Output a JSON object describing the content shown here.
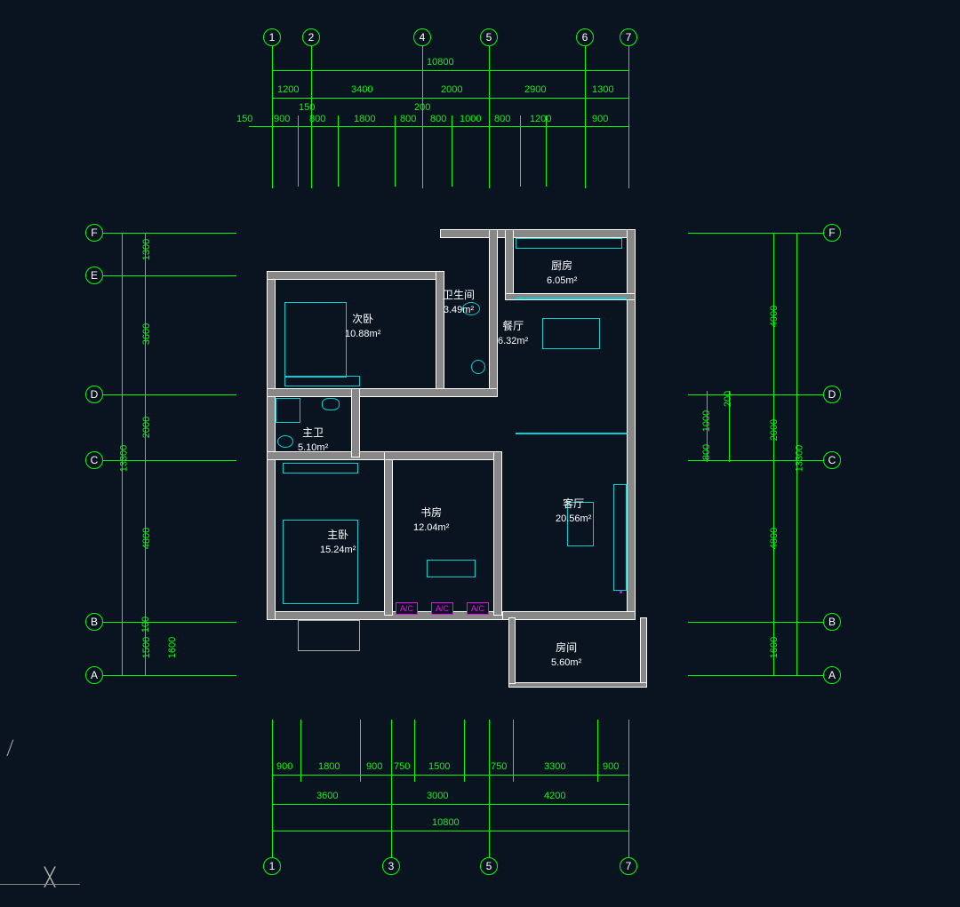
{
  "total_width": "10800",
  "total_height": "13300",
  "top_grids": [
    "1",
    "2",
    "4",
    "5",
    "6",
    "7"
  ],
  "left_grids": [
    "F",
    "E",
    "D",
    "C",
    "B",
    "A"
  ],
  "right_grids": [
    "F",
    "D",
    "C",
    "B",
    "A"
  ],
  "bottom_grids": [
    "1",
    "3",
    "5",
    "7"
  ],
  "dim_top_row1": [
    "1200",
    "3400",
    "2000",
    "2900",
    "1300"
  ],
  "dim_top_row2_edge": "150",
  "dim_top_row2": [
    "900",
    "800",
    "1800",
    "800",
    "800",
    "1000",
    "800",
    "1200",
    "900"
  ],
  "dim_top_extra": [
    "150",
    "200"
  ],
  "dim_left_col": [
    "1300",
    "3600",
    "2000",
    "4800",
    "100",
    "1500",
    "1600"
  ],
  "dim_left_total": "13300",
  "dim_right_col": [
    "4900",
    "200",
    "1000",
    "800",
    "2000",
    "4800",
    "1600"
  ],
  "dim_right_total": "13300",
  "dim_bottom_row1": [
    "900",
    "1800",
    "900",
    "750",
    "1500",
    "750",
    "3300",
    "900"
  ],
  "dim_bottom_row2": [
    "3600",
    "3000",
    "4200"
  ],
  "dim_bottom_total": "10800",
  "rooms": {
    "kitchen": {
      "name": "厨房",
      "area": "6.05m²"
    },
    "bathroom": {
      "name": "卫生间",
      "area": "3.49m²"
    },
    "dining": {
      "name": "餐厅",
      "area": "6.32m²"
    },
    "bed2": {
      "name": "次卧",
      "area": "10.88m²"
    },
    "masterbath": {
      "name": "主卫",
      "area": "5.10m²"
    },
    "study": {
      "name": "书房",
      "area": "12.04m²"
    },
    "living": {
      "name": "客厅",
      "area": "20.56m²"
    },
    "master": {
      "name": "主卧",
      "area": "15.24m²"
    },
    "room": {
      "name": "房间",
      "area": "5.60m²"
    }
  },
  "ac_labels": [
    "A/C",
    "A/C",
    "A/C"
  ]
}
